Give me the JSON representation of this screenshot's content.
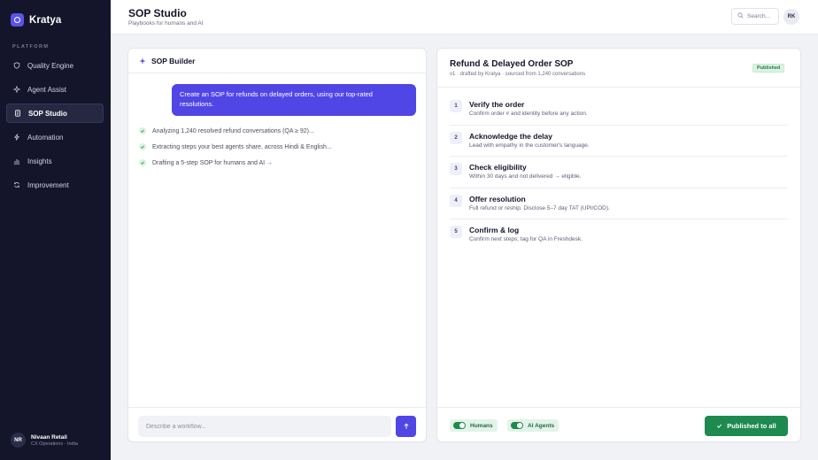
{
  "brand": {
    "name": "Kratya"
  },
  "sidebar": {
    "section_label": "PLATFORM",
    "items": [
      {
        "label": "Quality Engine",
        "icon": "shield-icon"
      },
      {
        "label": "Agent Assist",
        "icon": "sparkle-icon"
      },
      {
        "label": "SOP Studio",
        "icon": "document-icon",
        "active": true
      },
      {
        "label": "Automation",
        "icon": "bolt-icon"
      },
      {
        "label": "Insights",
        "icon": "bar-chart-icon"
      },
      {
        "label": "Improvement",
        "icon": "refresh-icon"
      }
    ],
    "user": {
      "initials": "NR",
      "name": "Nivaan Retail",
      "subtitle": "CX Operations · India"
    }
  },
  "header": {
    "title": "SOP Studio",
    "subtitle": "Playbooks for humans and AI",
    "search_placeholder": "Search...",
    "user_initials": "RK"
  },
  "builder": {
    "title": "SOP Builder",
    "user_message": "Create an SOP for refunds on delayed orders, using our top-rated resolutions.",
    "progress": [
      "Analyzing 1,240 resolved refund conversations (QA ≥ 92)...",
      "Extracting steps your best agents share, across Hindi & English...",
      "Drafting a 5-step SOP for humans and AI →"
    ],
    "input_placeholder": "Describe a workflow..."
  },
  "sop": {
    "title": "Refund & Delayed Order SOP",
    "subtitle": "v1 · drafted by Kratya · sourced from 1,240 conversations",
    "status": "Published",
    "steps": [
      {
        "num": "1",
        "title": "Verify the order",
        "desc": "Confirm order # and identity before any action."
      },
      {
        "num": "2",
        "title": "Acknowledge the delay",
        "desc": "Lead with empathy in the customer's language."
      },
      {
        "num": "3",
        "title": "Check eligibility",
        "desc": "Within 30 days and not delivered → eligible."
      },
      {
        "num": "4",
        "title": "Offer resolution",
        "desc": "Full refund or reship. Disclose 5–7 day TAT (UPI/COD)."
      },
      {
        "num": "5",
        "title": "Confirm & log",
        "desc": "Confirm next steps; tag for QA in Freshdesk."
      }
    ],
    "toggles": {
      "humans": "Humans",
      "ai_agents": "AI Agents"
    },
    "publish_label": "Published to all"
  },
  "colors": {
    "accent": "#5046e5",
    "sidebar_bg": "#14152b",
    "success": "#1e8a4f"
  }
}
